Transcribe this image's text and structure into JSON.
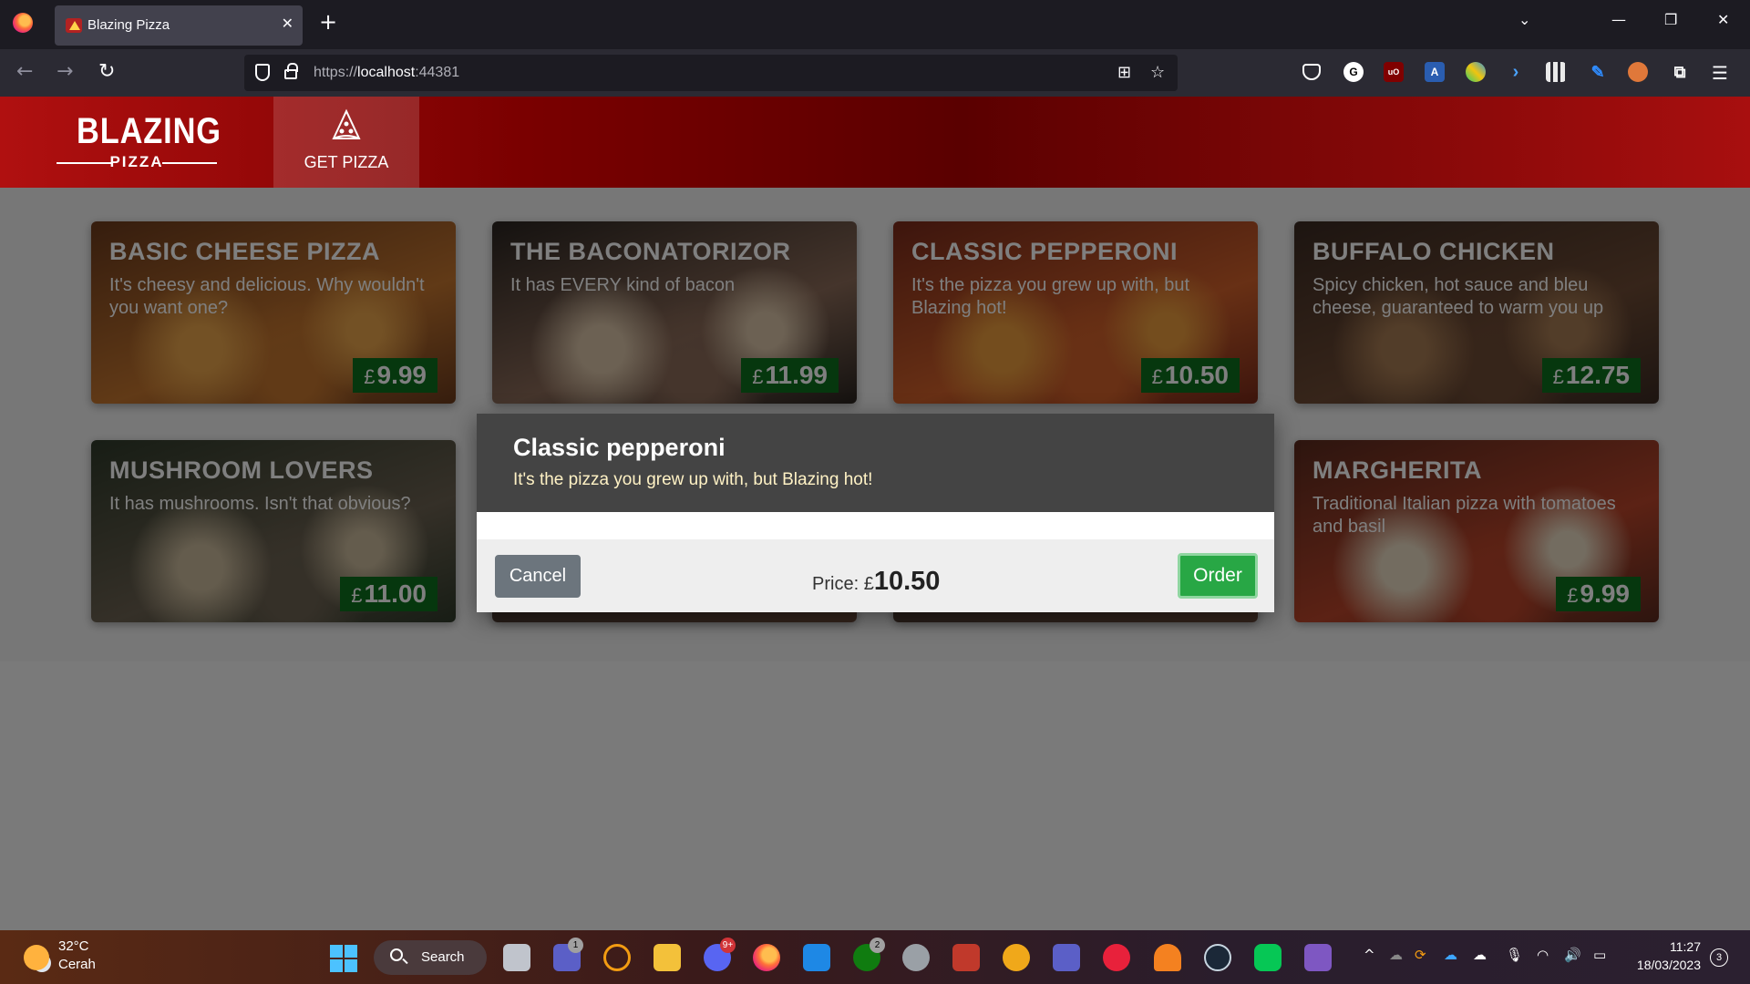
{
  "browser": {
    "tab_title": "Blazing Pizza",
    "tab_close": "✕",
    "new_tab": "+",
    "url_scheme": "https://",
    "url_host": "localhost",
    "url_port": ":44381",
    "back": "←",
    "forward": "→",
    "reload": "↻",
    "list_all_tabs": "⌄",
    "minimize": "—",
    "restore": "❐",
    "close": "✕",
    "menu": "☰"
  },
  "app": {
    "logo_main": "BLAZING",
    "logo_sub": "PIZZA",
    "nav_get_pizza": "GET PIZZA"
  },
  "specials": [
    {
      "name": "Basic Cheese Pizza",
      "description": "It's cheesy and delicious. Why wouldn't you want one?",
      "currency": "£",
      "price": "9.99",
      "colors": [
        "#6b3a1c",
        "#c2742e",
        "#e6a24a"
      ]
    },
    {
      "name": "The Baconatorizor",
      "description": "It has EVERY kind of bacon",
      "currency": "£",
      "price": "11.99",
      "colors": [
        "#2a2420",
        "#8a6a58",
        "#d9c3a7"
      ]
    },
    {
      "name": "Classic pepperoni",
      "description": "It's the pizza you grew up with, but Blazing hot!",
      "currency": "£",
      "price": "10.50",
      "colors": [
        "#7a2a1a",
        "#d0602a",
        "#e89a3c"
      ]
    },
    {
      "name": "Buffalo chicken",
      "description": "Spicy chicken, hot sauce and bleu cheese, guaranteed to warm you up",
      "currency": "£",
      "price": "12.75",
      "colors": [
        "#3a2a22",
        "#6d4a34",
        "#a57a52"
      ]
    },
    {
      "name": "Mushroom Lovers",
      "description": "It has mushrooms. Isn't that obvious?",
      "currency": "£",
      "price": "11.00",
      "colors": [
        "#2f3a2a",
        "#6a6050",
        "#c8b89a"
      ]
    },
    {
      "name": "Margherita",
      "description": "Traditional Italian pizza with tomatoes and basil",
      "currency": "£",
      "price": "9.99",
      "colors": [
        "#5a2a1e",
        "#b8442a",
        "#e7d8c0"
      ]
    }
  ],
  "dialog": {
    "title": "Classic pepperoni",
    "description": "It's the pizza you grew up with, but Blazing hot!",
    "cancel_label": "Cancel",
    "price_label": "Price:",
    "price_currency": "£",
    "price_value": "10.50",
    "order_label": "Order"
  },
  "taskbar": {
    "temperature": "32°C",
    "condition": "Cerah",
    "search_label": "Search",
    "chat_badge": "1",
    "discord_badge": "9+",
    "xbox_badge": "2",
    "time": "11:27",
    "date": "18/03/2023",
    "notifications": "3"
  },
  "colors": {
    "header_red": "#7a0000",
    "price_green": "#0d6e1d",
    "order_green": "#28a745",
    "cancel_gray": "#6c757d",
    "dialog_header": "#444444"
  }
}
